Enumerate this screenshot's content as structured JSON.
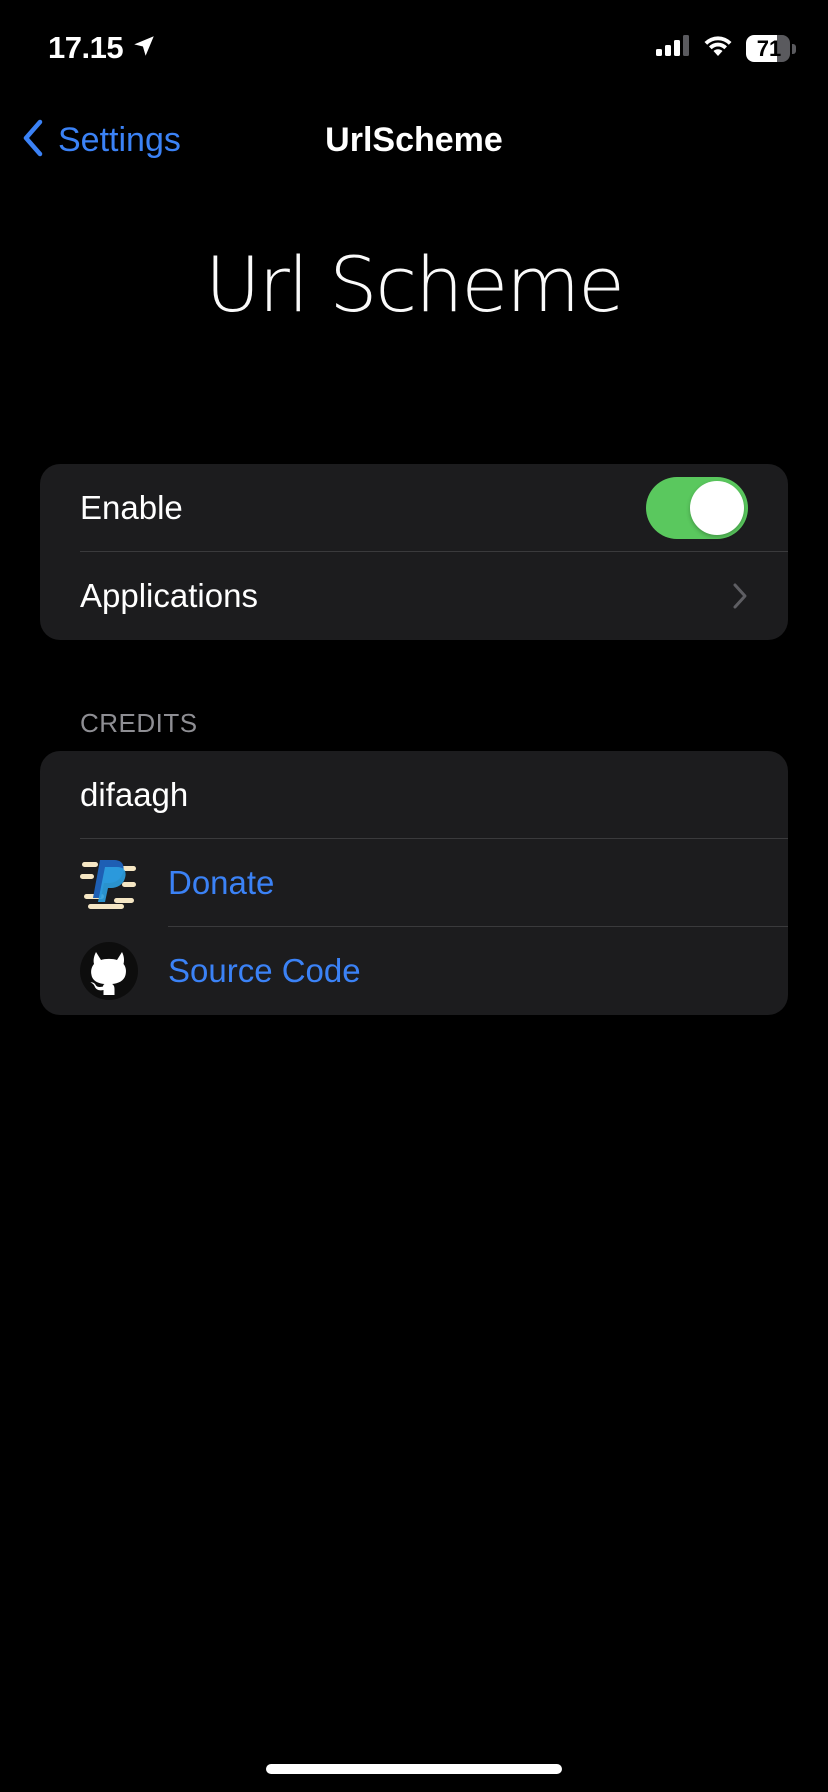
{
  "status_bar": {
    "time": "17.15",
    "battery_percent": 71,
    "battery_label": "71",
    "icons": [
      "location-arrow-icon",
      "cellular-signal-icon",
      "wifi-icon",
      "battery-icon"
    ]
  },
  "nav": {
    "back_label": "Settings",
    "title": "UrlScheme"
  },
  "header": {
    "title": "Url Scheme"
  },
  "settings_group": {
    "enable": {
      "label": "Enable",
      "value": true
    },
    "applications": {
      "label": "Applications"
    }
  },
  "credits": {
    "header": "CREDITS",
    "author": "difaagh",
    "donate": {
      "label": "Donate",
      "icon": "paypal-icon"
    },
    "source_code": {
      "label": "Source Code",
      "icon": "github-icon"
    }
  },
  "colors": {
    "accent": "#3b82f6",
    "toggle_on": "#5ac85e",
    "cell_background": "#1c1c1e",
    "section_header": "#8e8e93"
  }
}
